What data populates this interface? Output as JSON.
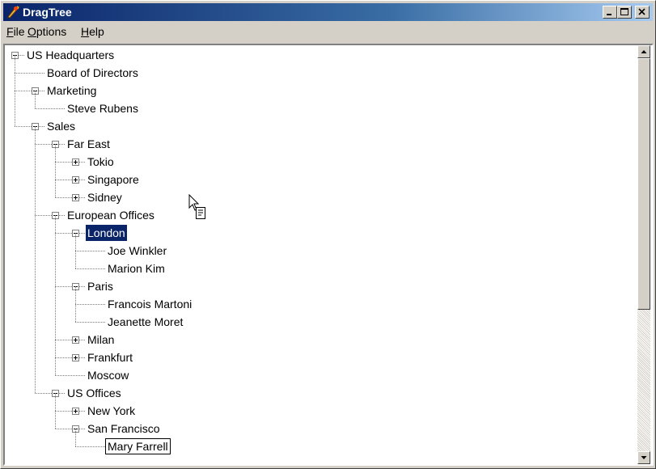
{
  "window": {
    "title": "DragTree",
    "icons": [
      "app-icon",
      "minimize-icon",
      "maximize-icon",
      "close-icon"
    ]
  },
  "menu": [
    {
      "label": "File",
      "accel": "F",
      "rest": "ile"
    },
    {
      "label": "Options",
      "accel": "O",
      "rest": "ptions"
    },
    {
      "label": "Help",
      "accel": "H",
      "rest": "elp"
    }
  ],
  "tree": {
    "nodes": [
      {
        "label": "US Headquarters",
        "level": 0,
        "expander": "minus"
      },
      {
        "label": "Board of Directors",
        "level": 1,
        "expander": "none"
      },
      {
        "label": "Marketing",
        "level": 1,
        "expander": "minus"
      },
      {
        "label": "Steve Rubens",
        "level": 2,
        "expander": "none"
      },
      {
        "label": "Sales",
        "level": 1,
        "expander": "minus"
      },
      {
        "label": "Far East",
        "level": 2,
        "expander": "minus"
      },
      {
        "label": "Tokio",
        "level": 3,
        "expander": "plus"
      },
      {
        "label": "Singapore",
        "level": 3,
        "expander": "plus"
      },
      {
        "label": "Sidney",
        "level": 3,
        "expander": "plus"
      },
      {
        "label": "European Offices",
        "level": 2,
        "expander": "minus"
      },
      {
        "label": "London",
        "level": 3,
        "expander": "minus",
        "state": "selected"
      },
      {
        "label": "Joe Winkler",
        "level": 4,
        "expander": "none"
      },
      {
        "label": "Marion Kim",
        "level": 4,
        "expander": "none"
      },
      {
        "label": "Paris",
        "level": 3,
        "expander": "minus"
      },
      {
        "label": "Francois Martoni",
        "level": 4,
        "expander": "none"
      },
      {
        "label": "Jeanette Moret",
        "level": 4,
        "expander": "none"
      },
      {
        "label": "Milan",
        "level": 3,
        "expander": "plus"
      },
      {
        "label": "Frankfurt",
        "level": 3,
        "expander": "plus"
      },
      {
        "label": "Moscow",
        "level": 3,
        "expander": "none"
      },
      {
        "label": "US Offices",
        "level": 2,
        "expander": "minus"
      },
      {
        "label": "New York",
        "level": 3,
        "expander": "plus"
      },
      {
        "label": "San Francisco",
        "level": 3,
        "expander": "minus"
      },
      {
        "label": "Mary Farrell",
        "level": 4,
        "expander": "none",
        "state": "editing"
      }
    ]
  },
  "scrollbar": {
    "position": 0,
    "visible_fraction": 0.64
  },
  "colors": {
    "face": "#d4d0c8",
    "title_start": "#0a246a",
    "selection": "#0a246a"
  }
}
